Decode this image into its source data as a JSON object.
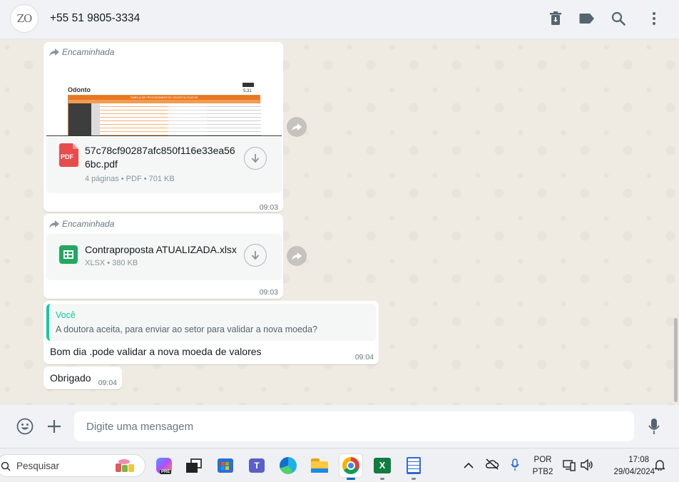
{
  "header": {
    "avatar_text": "ZO",
    "contact_name": "+55 51 9805-3334",
    "icons": [
      "trash-icon",
      "label-icon",
      "search-icon",
      "menu-icon"
    ]
  },
  "messages": {
    "forwarded_label": "Encaminhada",
    "pdf": {
      "preview_logo": "Odonto",
      "preview_title": "TABELA DE PROCEDIMENTOS ODONTOLÓGICOS",
      "preview_price": "5,31",
      "file_name": "57c78cf90287afc850f116e33ea566bc.pdf",
      "meta": "4 páginas • PDF • 701 KB",
      "badge": "PDF",
      "time": "09:03"
    },
    "xlsx": {
      "file_name": "Contraproposta ATUALIZADA.xlsx",
      "meta": "XLSX • 380 KB",
      "time": "09:03"
    },
    "reply": {
      "quote_author": "Você",
      "quote_text": "A doutora aceita, para enviar ao setor para validar a nova moeda?",
      "text": "Bom dia .pode validar a nova moeda de valores",
      "time": "09:04"
    },
    "thanks": {
      "text": "Obrigado",
      "time": "09:04"
    }
  },
  "composer": {
    "placeholder": "Digite uma mensagem"
  },
  "taskbar": {
    "search_placeholder": "Pesquisar",
    "language_top": "POR",
    "language_bottom": "PTB2",
    "time": "17:08",
    "date": "29/04/2024"
  },
  "colors": {
    "accent_green": "#06cf9c",
    "chat_bg": "#efeae2",
    "pdf_red": "#e74c4c",
    "sheet_green": "#22a860"
  }
}
